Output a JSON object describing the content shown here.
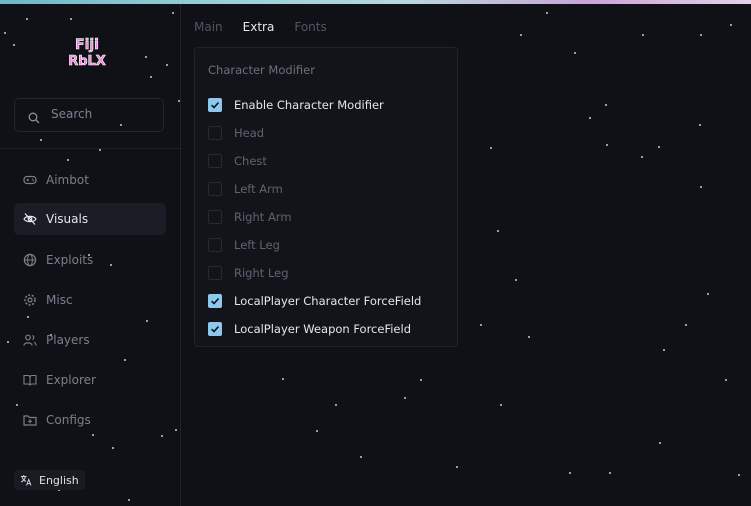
{
  "app": {
    "logo_text": "Fiji RbLX"
  },
  "search": {
    "placeholder": "Search"
  },
  "sidebar": {
    "items": [
      {
        "label": "Aimbot",
        "icon": "gamepad-icon"
      },
      {
        "label": "Visuals",
        "icon": "eye-off-icon",
        "active": true
      },
      {
        "label": "Exploits",
        "icon": "globe-icon"
      },
      {
        "label": "Misc",
        "icon": "gear-icon"
      },
      {
        "label": "Players",
        "icon": "users-icon"
      },
      {
        "label": "Explorer",
        "icon": "book-icon"
      },
      {
        "label": "Configs",
        "icon": "folder-icon"
      }
    ]
  },
  "language": {
    "label": "English",
    "icon": "translate-icon"
  },
  "tabs": [
    {
      "label": "Main",
      "active": false
    },
    {
      "label": "Extra",
      "active": true
    },
    {
      "label": "Fonts",
      "active": false
    }
  ],
  "panel": {
    "title": "Character Modifier",
    "options": [
      {
        "label": "Enable Character Modifier",
        "checked": true
      },
      {
        "label": "Head",
        "checked": false
      },
      {
        "label": "Chest",
        "checked": false
      },
      {
        "label": "Left Arm",
        "checked": false
      },
      {
        "label": "Right Arm",
        "checked": false
      },
      {
        "label": "Left Leg",
        "checked": false
      },
      {
        "label": "Right Leg",
        "checked": false
      },
      {
        "label": "LocalPlayer Character ForceField",
        "checked": true
      },
      {
        "label": "LocalPlayer Weapon ForceField",
        "checked": true
      }
    ]
  },
  "colors": {
    "accent": "#8ec8ee",
    "background": "#0f1117",
    "logo": "#e98ad6"
  }
}
